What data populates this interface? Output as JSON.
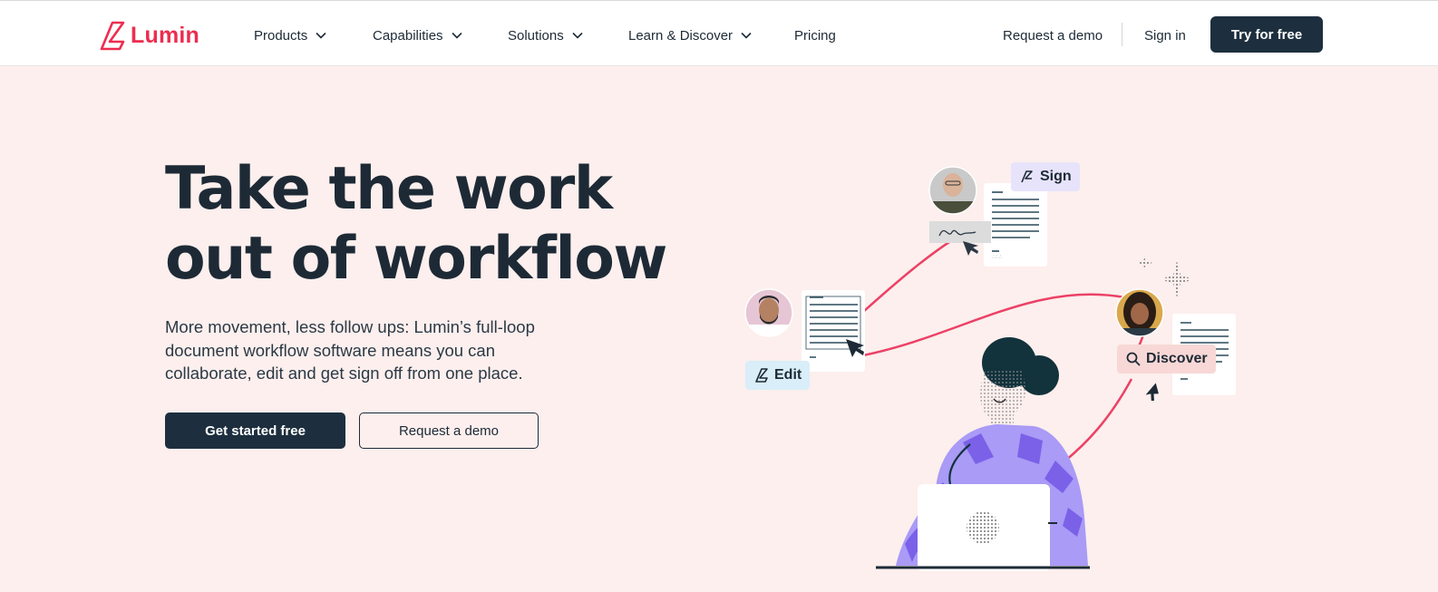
{
  "brand": {
    "name": "Lumin",
    "color": "#ec2d4f",
    "logo_icon": "lumin-logo-icon"
  },
  "nav": {
    "items": [
      {
        "label": "Products",
        "has_dropdown": true
      },
      {
        "label": "Capabilities",
        "has_dropdown": true
      },
      {
        "label": "Solutions",
        "has_dropdown": true
      },
      {
        "label": "Learn & Discover",
        "has_dropdown": true
      },
      {
        "label": "Pricing",
        "has_dropdown": false
      }
    ],
    "request_demo": "Request a demo",
    "sign_in": "Sign in",
    "try_free": "Try for free"
  },
  "hero": {
    "title_line1": "Take the work",
    "title_line2": "out of workflow",
    "subtitle": "More movement, less follow ups: Lumin’s full-loop document workflow software means you can collaborate, edit and get sign off from one place.",
    "primary_cta": "Get started free",
    "secondary_cta": "Request a demo"
  },
  "illustration": {
    "tags": {
      "sign": "Sign",
      "edit": "Edit",
      "discover": "Discover"
    }
  },
  "colors": {
    "navy": "#1d2f3e",
    "hero_bg": "#fcefed",
    "accent_pink": "#ec2d4f",
    "sign_tag_bg": "#e6e3fb",
    "edit_tag_bg": "#d9eef8",
    "discover_tag_bg": "#f8d8d6",
    "sweater_purple": "#8f7df0"
  }
}
